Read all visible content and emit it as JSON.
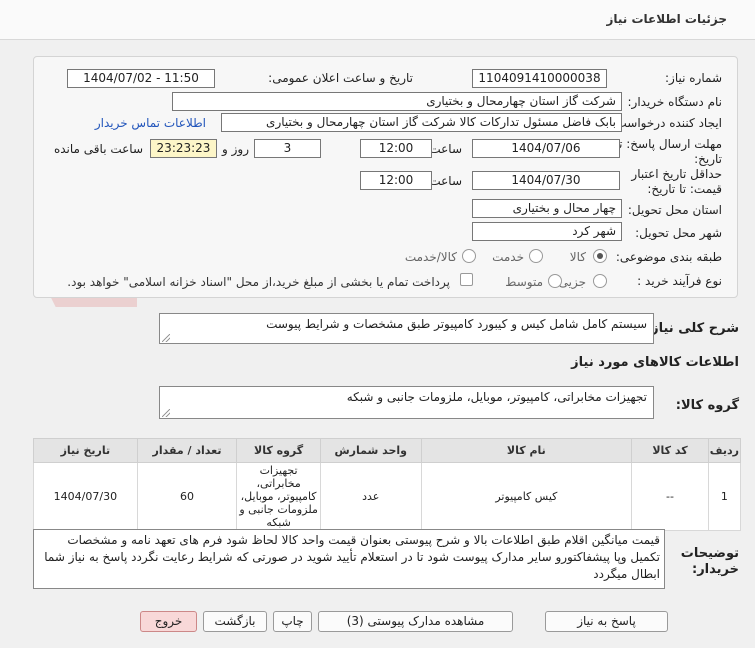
{
  "header": {
    "title": "جزئیات اطلاعات نیاز"
  },
  "form": {
    "need_number": {
      "label": "شماره نیاز:",
      "value": "1104091410000038"
    },
    "announce": {
      "label": "تاریخ و ساعت اعلان عمومی:",
      "value": "1404/07/02 - 11:50"
    },
    "buyer_org": {
      "label": "نام دستگاه خریدار:",
      "value": "شرکت گاز استان چهارمحال و بختیاری"
    },
    "creator": {
      "label": "ایجاد کننده درخواست:",
      "value": "بابک فاضل  مسئول تدارکات کالا شرکت گاز استان چهارمحال و بختیاری",
      "contact_link": "اطلاعات تماس خریدار"
    },
    "reply_deadline": {
      "label_line1": "مهلت ارسال پاسخ: تا",
      "label_line2": "تاریخ:",
      "date": "1404/07/06",
      "time_label": "ساعت",
      "time": "12:00",
      "days": "3",
      "days_label": "روز و",
      "remaining": "23:23:23",
      "remaining_label": "ساعت باقی مانده"
    },
    "price_validity": {
      "label_line1": "حداقل تاریخ اعتبار",
      "label_line2": "قیمت: تا تاریخ:",
      "date": "1404/07/30",
      "time_label": "ساعت",
      "time": "12:00"
    },
    "province": {
      "label": "استان محل تحویل:",
      "value": "چهار محال و بختیاری"
    },
    "city": {
      "label": "شهر محل تحویل:",
      "value": "شهر کرد"
    },
    "category": {
      "label": "طبقه بندی موضوعی:",
      "options": [
        "کالا",
        "خدمت",
        "کالا/خدمت"
      ],
      "selected": "کالا"
    },
    "purchase_type": {
      "label": "نوع فرآیند خرید :",
      "options": [
        "جزیی",
        "متوسط"
      ],
      "selected": "",
      "payment_note": "پرداخت تمام یا بخشی از مبلغ خرید،از محل \"اسناد خزانه اسلامی\" خواهد بود."
    }
  },
  "summary": {
    "label": "شرح کلی نیاز:",
    "value": "سیستم کامل شامل کیس و کیبورد کامپیوتر طبق مشخصات و شرایط پیوست"
  },
  "goods_section": {
    "title": "اطلاعات کالاهای مورد نیاز"
  },
  "goods_group": {
    "label": "گروه کالا:",
    "value": "تجهیزات مخابراتی، کامپیوتر، موبایل، ملزومات جانبی و شبکه"
  },
  "table": {
    "headers": [
      "ردیف",
      "کد کالا",
      "نام کالا",
      "واحد شمارش",
      "گروه کالا",
      "تعداد / مقدار",
      "تاریخ نیاز"
    ],
    "rows": [
      {
        "row": "1",
        "code": "--",
        "name": "کیس کامپیوتر",
        "unit": "عدد",
        "group": "تجهیزات مخابراتی، کامپیوتر، موبایل، ملزومات جانبی و شبکه",
        "qty": "60",
        "date": "1404/07/30"
      }
    ]
  },
  "notes": {
    "label_line1": "توضیحات",
    "label_line2": "خریدار:",
    "value": "قیمت میانگین اقلام طبق اطلاعات بالا و شرح پیوستی بعنوان قیمت واحد  کالا  لحاظ شود فرم های تعهد نامه و مشخصات تکمیل وپا پیشفاکتورو سایر مدارک پیوست شود تا در استعلام تأیید شوید در صورتی که شرایط رعایت نگردد پاسخ به نیاز شما ابطال میگردد"
  },
  "buttons": {
    "reply": "پاسخ به نیاز",
    "docs": "مشاهده مدارک پیوستی (3)",
    "print": "چاپ",
    "back": "بازگشت",
    "exit": "خروج"
  },
  "colors": {
    "link": "#2255bb",
    "remaining_bg": "#fdf6c8",
    "exit_bg": "#f8d8d8"
  }
}
